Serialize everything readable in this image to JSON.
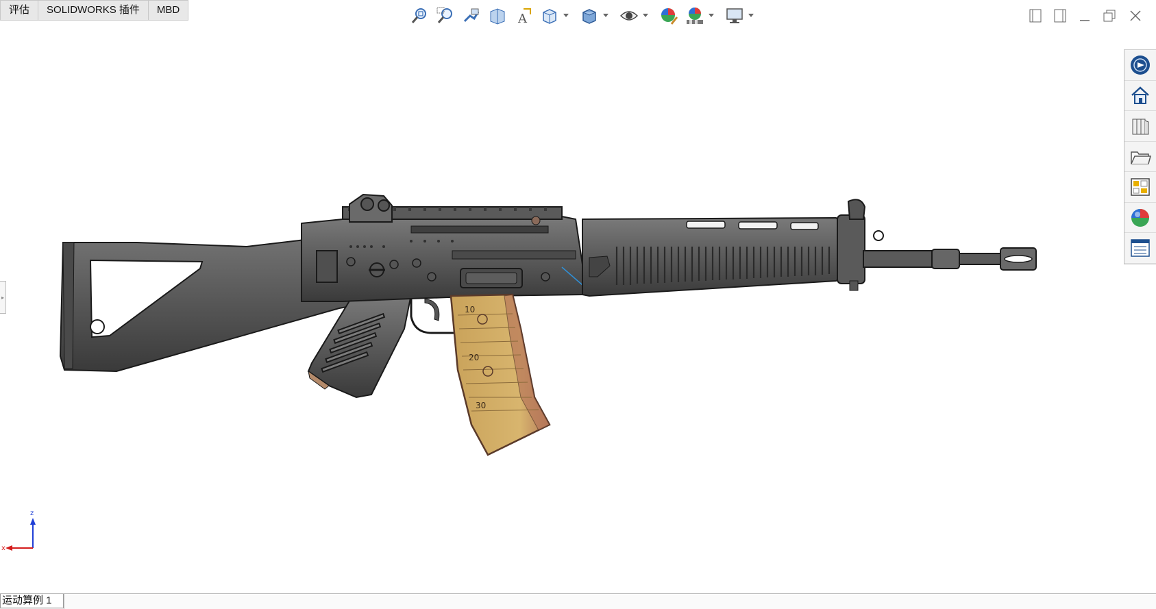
{
  "command_tabs": [
    {
      "label": "评估"
    },
    {
      "label": "SOLIDWORKS 插件"
    },
    {
      "label": "MBD"
    }
  ],
  "heads_up_toolbar": [
    {
      "icon": "zoom-to-fit-icon"
    },
    {
      "icon": "zoom-to-area-icon"
    },
    {
      "icon": "previous-view-icon"
    },
    {
      "icon": "section-view-icon"
    },
    {
      "icon": "dynamic-annotation-views-icon"
    },
    {
      "icon": "view-orientation-icon",
      "dropdown": true
    },
    {
      "icon": "display-style-icon",
      "dropdown": true
    },
    {
      "icon": "hide-show-items-icon",
      "dropdown": true
    },
    {
      "icon": "edit-appearance-icon"
    },
    {
      "icon": "apply-scene-icon",
      "dropdown": true
    },
    {
      "icon": "view-settings-icon",
      "dropdown": true
    }
  ],
  "window_controls": [
    "tile-left-icon",
    "tile-right-icon",
    "minimize-icon",
    "restore-icon",
    "close-icon"
  ],
  "task_pane": [
    {
      "icon": "solidworks-resources-icon"
    },
    {
      "icon": "3dexperience-home-icon"
    },
    {
      "icon": "design-library-icon"
    },
    {
      "icon": "file-explorer-icon"
    },
    {
      "icon": "view-palette-icon"
    },
    {
      "icon": "appearances-scenes-icon"
    },
    {
      "icon": "custom-properties-icon"
    }
  ],
  "model": {
    "magazine_marks": [
      "10",
      "20",
      "30"
    ],
    "colors": {
      "body": "#585858",
      "body_dark": "#2c2c2c",
      "magazine": "#c9a25a",
      "magazine_edge": "#8a5a3a",
      "edge": "#1a1a1a"
    }
  },
  "triad": {
    "z_label": "z",
    "x_label": "x",
    "z_color": "#1f3fd6",
    "x_color": "#d41c1c"
  },
  "status_bar": {
    "tab_label": "运动算例 1"
  }
}
